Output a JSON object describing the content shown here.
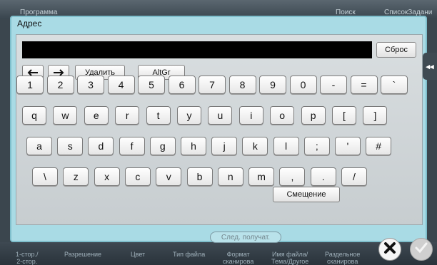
{
  "background": {
    "top_items": [
      "Программа",
      "Поиск",
      "СписокЗадани"
    ],
    "bottom_items": [
      "1-стор./\n2-стор.",
      "Разрешение",
      "Цвет",
      "Тип файла",
      "Формат\nсканирова",
      "Имя файла/\nТема/Другое",
      "Раздельное\nсканирова"
    ]
  },
  "dialog": {
    "title": "Адрес",
    "reset_label": "Сброс",
    "toolbar": {
      "delete_label": "Удалить",
      "altgr_label": "AltGr"
    },
    "keyboard": {
      "row1": [
        "1",
        "2",
        "3",
        "4",
        "5",
        "6",
        "7",
        "8",
        "9",
        "0",
        "-",
        "=",
        "`"
      ],
      "row2": [
        "q",
        "w",
        "e",
        "r",
        "t",
        "y",
        "u",
        "i",
        "o",
        "p",
        "[",
        "]"
      ],
      "row3": [
        "a",
        "s",
        "d",
        "f",
        "g",
        "h",
        "j",
        "k",
        "l",
        ";",
        "'",
        "#"
      ],
      "row4": [
        "\\",
        "z",
        "x",
        "c",
        "v",
        "b",
        "n",
        "m",
        ",",
        ".",
        "/"
      ]
    },
    "shift_label": "Смещение",
    "next_label": "След. получат."
  },
  "icons": {
    "left": "arrow-left-icon",
    "right": "arrow-right-icon",
    "collapse": "double-chevron-left-icon",
    "close": "close-icon",
    "ok": "checkmark-icon"
  }
}
